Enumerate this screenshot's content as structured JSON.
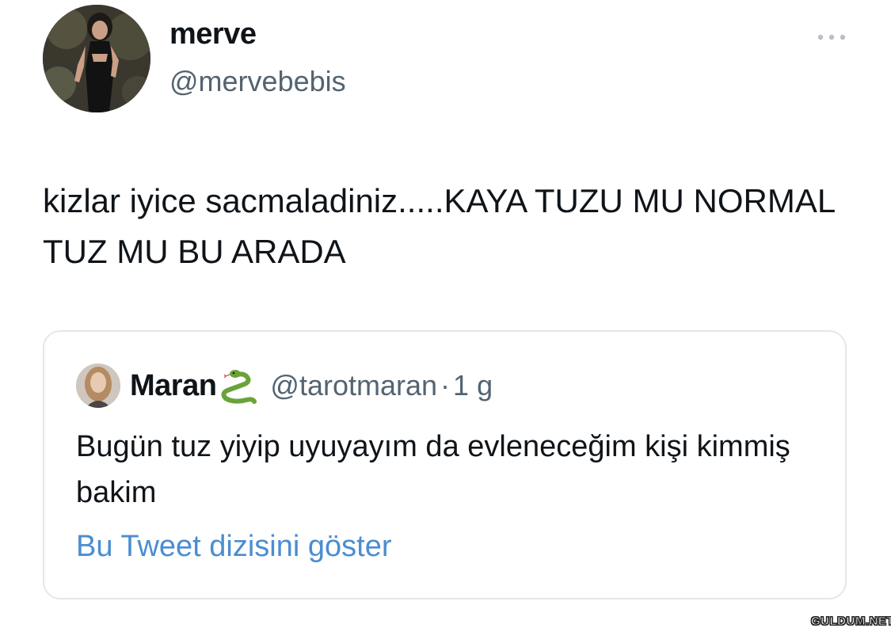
{
  "tweet": {
    "author": {
      "display_name": "merve",
      "handle": "@mervebebis",
      "avatar_icon": "profile-photo"
    },
    "more_icon": "more-horizontal-icon",
    "text": "kizlar iyice sacmaladiniz.....KAYA TUZU MU NORMAL TUZ MU BU ARADA"
  },
  "quote": {
    "author": {
      "display_name": "Maran",
      "emoji_icon": "snake-icon",
      "handle": "@tarotmaran",
      "separator": "·",
      "time": "1 g",
      "avatar_icon": "profile-photo"
    },
    "text": "Bugün tuz yiyip uyuyayım da evleneceğim kişi kimmiş bakim",
    "show_thread_label": "Bu Tweet dizisini göster",
    "link_color": "#4a8dd1"
  },
  "watermark": "GULDUM.NET",
  "colors": {
    "text_primary": "#0f1419",
    "text_secondary": "#536471",
    "border": "#e3e7ea"
  }
}
